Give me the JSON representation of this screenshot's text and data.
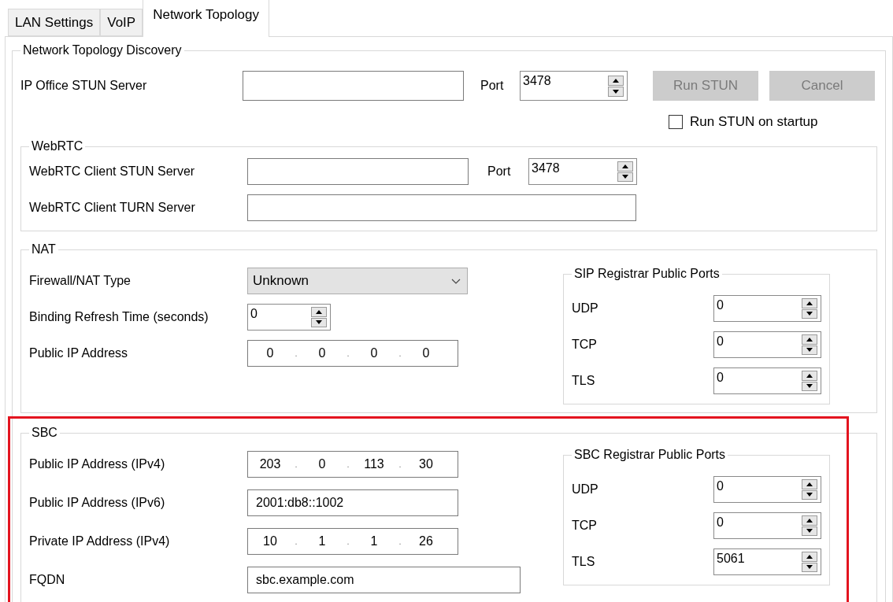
{
  "tabs": [
    {
      "label": "LAN Settings",
      "selected": false
    },
    {
      "label": "VoIP",
      "selected": false
    },
    {
      "label": "Network Topology",
      "selected": true
    }
  ],
  "discovery": {
    "title": "Network Topology Discovery",
    "stun_label": "IP Office STUN Server",
    "port_label": "Port",
    "port_value": "3478",
    "buttons": [
      {
        "label": "Run STUN",
        "disabled": true
      },
      {
        "label": "Cancel",
        "disabled": true
      }
    ],
    "startup": {
      "label": "Run STUN on startup",
      "checked": false
    }
  },
  "webrtc": {
    "title": "WebRTC",
    "rows": [
      {
        "kind": "text_port",
        "label": "WebRTC Client STUN Server",
        "port_label": "Port",
        "port_value": "3478"
      },
      {
        "kind": "wide_text",
        "label": "WebRTC Client TURN Server"
      }
    ]
  },
  "nat": {
    "title": "NAT",
    "rows": [
      {
        "kind": "select",
        "label": "Firewall/NAT Type",
        "value": "Unknown"
      },
      {
        "kind": "spin",
        "label": "Binding Refresh Time (seconds)",
        "value": "0"
      },
      {
        "kind": "ip",
        "label": "Public IP Address",
        "octets": [
          "0",
          "0",
          "0",
          "0"
        ],
        "separator": "."
      }
    ],
    "ports": {
      "title": "SIP Registrar Public Ports",
      "rows": [
        {
          "label": "UDP",
          "value": "0"
        },
        {
          "label": "TCP",
          "value": "0"
        },
        {
          "label": "TLS",
          "value": "0"
        }
      ]
    }
  },
  "sbc": {
    "title": "SBC",
    "highlighted": true,
    "rows": [
      {
        "kind": "ip",
        "label": "Public IP Address (IPv4)",
        "octets": [
          "203",
          "0",
          "113",
          "30"
        ],
        "separator": "."
      },
      {
        "kind": "text",
        "label": "Public IP Address (IPv6)",
        "value": "2001:db8::1002"
      },
      {
        "kind": "ip",
        "label": "Private IP Address (IPv4)",
        "octets": [
          "10",
          "1",
          "1",
          "26"
        ],
        "separator": "."
      },
      {
        "kind": "long_text",
        "label": "FQDN",
        "value": "sbc.example.com"
      }
    ],
    "ports": {
      "title": "SBC Registrar Public Ports",
      "rows": [
        {
          "label": "UDP",
          "value": "0"
        },
        {
          "label": "TCP",
          "value": "0"
        },
        {
          "label": "TLS",
          "value": "5061"
        }
      ]
    }
  }
}
